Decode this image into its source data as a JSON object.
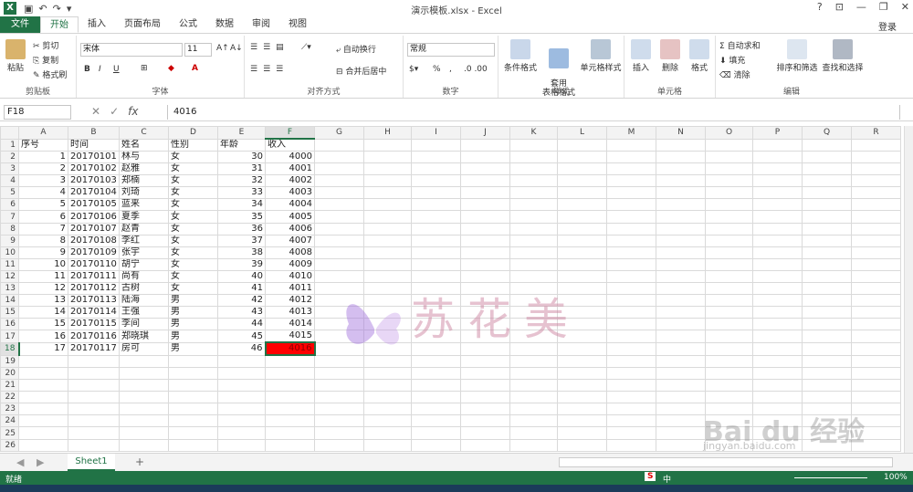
{
  "titlebar": {
    "app_icon": "X",
    "title": "演示模板.xlsx - Excel",
    "help": "?",
    "restore_ribbon": "⊡",
    "minimize": "—",
    "maximize": "❐",
    "close": "✕"
  },
  "tabs": [
    "文件",
    "开始",
    "插入",
    "页面布局",
    "公式",
    "数据",
    "审阅",
    "视图"
  ],
  "login": "登录",
  "ribbon": {
    "clipboard": {
      "label": "剪贴板",
      "paste": "粘贴",
      "cut": "剪切",
      "copy": "复制",
      "format_painter": "格式刷"
    },
    "font": {
      "label": "字体",
      "name": "宋体",
      "size": "11",
      "bold": "B",
      "italic": "I",
      "underline": "U"
    },
    "alignment": {
      "label": "对齐方式",
      "wrap": "自动换行",
      "merge": "合并后居中"
    },
    "number": {
      "label": "数字",
      "format": "常规",
      "percent": "%",
      "comma": ","
    },
    "styles": {
      "label": "样式",
      "conditional": "条件格式",
      "table": "套用\n表格格式",
      "cell_styles": "单元格样式"
    },
    "cells": {
      "label": "单元格",
      "insert": "插入",
      "delete": "删除",
      "format": "格式"
    },
    "editing": {
      "label": "编辑",
      "autosum": "自动求和",
      "fill": "填充",
      "clear": "清除",
      "sort": "排序和筛选",
      "find": "查找和选择"
    }
  },
  "formula_bar": {
    "name_box": "F18",
    "fx": "fx",
    "value": "4016"
  },
  "columns": [
    "A",
    "B",
    "C",
    "D",
    "E",
    "F",
    "G",
    "H",
    "I",
    "J",
    "K",
    "L",
    "M",
    "N",
    "O",
    "P",
    "Q",
    "R"
  ],
  "selected_col": "F",
  "selected_row": 18,
  "header_row": [
    "序号",
    "时间",
    "姓名",
    "性别",
    "年龄",
    "收入"
  ],
  "rows": [
    [
      "1",
      "20170101",
      "林与",
      "女",
      "30",
      "4000"
    ],
    [
      "2",
      "20170102",
      "赵雅",
      "女",
      "31",
      "4001"
    ],
    [
      "3",
      "20170103",
      "郑楠",
      "女",
      "32",
      "4002"
    ],
    [
      "4",
      "20170104",
      "刘琦",
      "女",
      "33",
      "4003"
    ],
    [
      "5",
      "20170105",
      "蓝来",
      "女",
      "34",
      "4004"
    ],
    [
      "6",
      "20170106",
      "夏季",
      "女",
      "35",
      "4005"
    ],
    [
      "7",
      "20170107",
      "赵青",
      "女",
      "36",
      "4006"
    ],
    [
      "8",
      "20170108",
      "李红",
      "女",
      "37",
      "4007"
    ],
    [
      "9",
      "20170109",
      "张宇",
      "女",
      "38",
      "4008"
    ],
    [
      "10",
      "20170110",
      "胡宁",
      "女",
      "39",
      "4009"
    ],
    [
      "11",
      "20170111",
      "尚有",
      "女",
      "40",
      "4010"
    ],
    [
      "12",
      "20170112",
      "古树",
      "女",
      "41",
      "4011"
    ],
    [
      "13",
      "20170113",
      "陆海",
      "男",
      "42",
      "4012"
    ],
    [
      "14",
      "20170114",
      "王强",
      "男",
      "43",
      "4013"
    ],
    [
      "15",
      "20170115",
      "李间",
      "男",
      "44",
      "4014"
    ],
    [
      "16",
      "20170116",
      "郑晓琪",
      "男",
      "45",
      "4015"
    ],
    [
      "17",
      "20170117",
      "房可",
      "男",
      "46",
      "4016"
    ]
  ],
  "empty_row_numbers": [
    19,
    20,
    21,
    22,
    23,
    24,
    25,
    26
  ],
  "sheet_tab": "Sheet1",
  "add_sheet": "+",
  "status": {
    "ready": "就绪",
    "zoom": "100%",
    "ime": "中"
  },
  "watermark": {
    "text": "苏花美",
    "brand": "Bai du 经验",
    "url": "jingyan.baidu.com"
  },
  "colors": {
    "excel_green": "#217346",
    "selected_fill": "#ff0000"
  }
}
